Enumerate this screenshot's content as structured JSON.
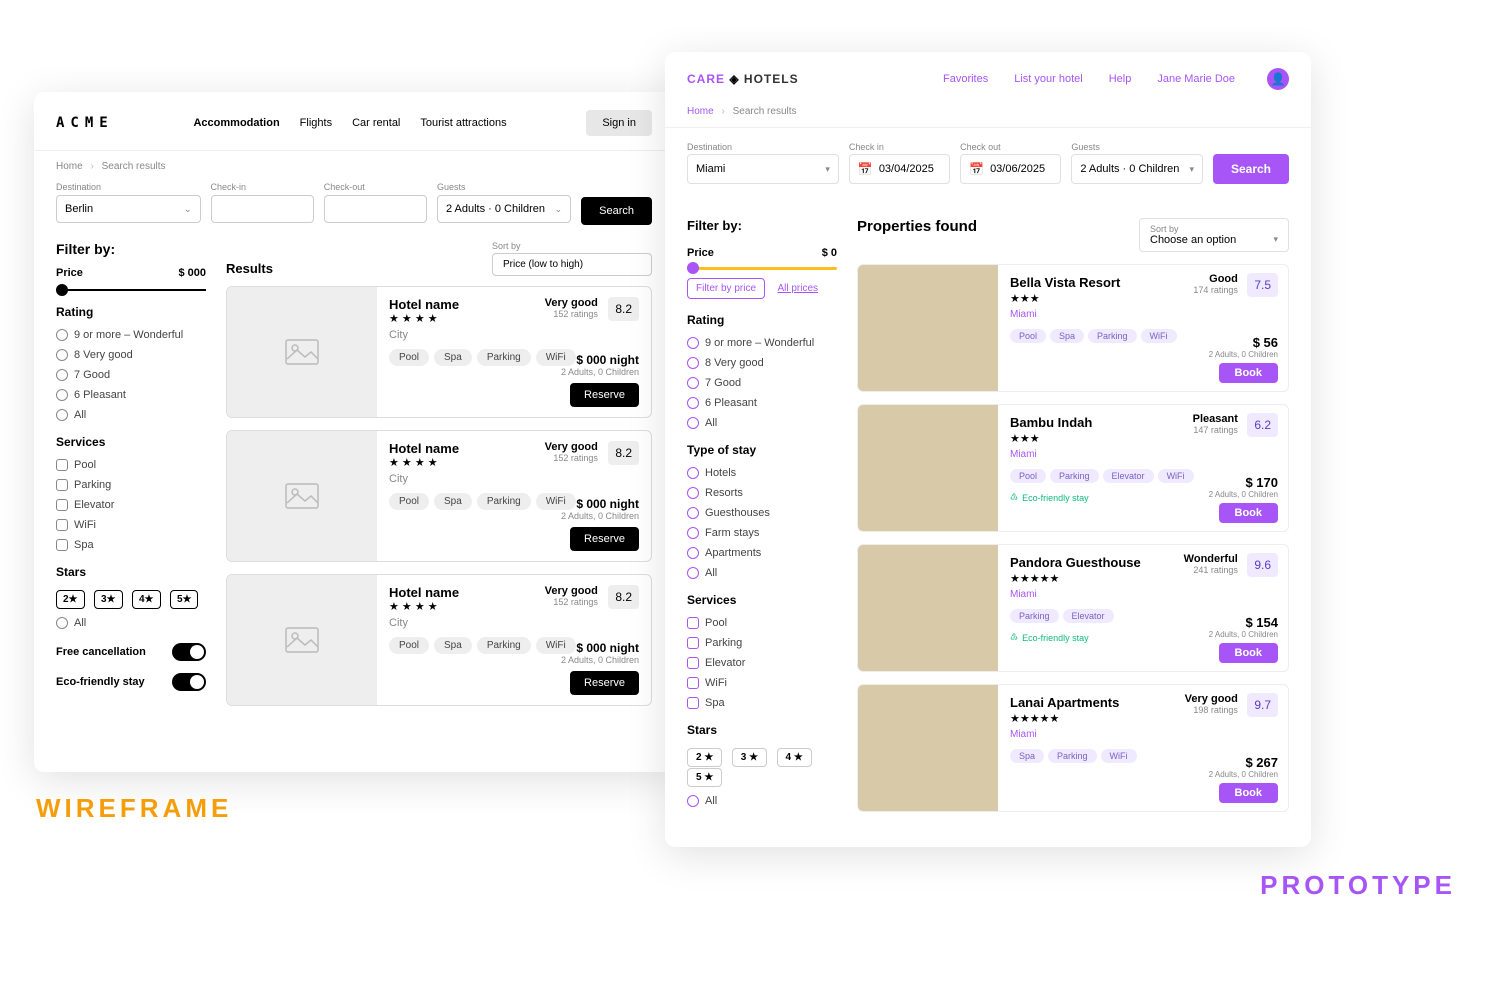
{
  "labels": {
    "wireframe": "WIREFRAME",
    "prototype": "PROTOTYPE"
  },
  "wire": {
    "brand": "ACME",
    "nav": [
      "Accommodation",
      "Flights",
      "Car rental",
      "Tourist attractions"
    ],
    "signin": "Sign in",
    "crumbs": {
      "home": "Home",
      "current": "Search results"
    },
    "search": {
      "destination_label": "Destination",
      "destination": "Berlin",
      "checkin_label": "Check-in",
      "checkin": "",
      "checkout_label": "Check-out",
      "checkout": "",
      "guests_label": "Guests",
      "guests": "2 Adults  ·  0 Children",
      "button": "Search"
    },
    "filter_by": "Filter by:",
    "price_label": "Price",
    "price_value": "$  000",
    "rating_label": "Rating",
    "ratings": [
      "9 or more – Wonderful",
      "8 Very good",
      "7 Good",
      "6 Pleasant",
      "All"
    ],
    "services_label": "Services",
    "services": [
      "Pool",
      "Parking",
      "Elevator",
      "WiFi",
      "Spa"
    ],
    "stars_label": "Stars",
    "stars": [
      "2★",
      "3★",
      "4★",
      "5★"
    ],
    "stars_all": "All",
    "freecancel": "Free cancellation",
    "ecofriendly": "Eco-friendly stay",
    "results_title": "Results",
    "sort_label": "Sort by",
    "sort_value": "Price (low to high)",
    "card": {
      "name": "Hotel name",
      "city": "City",
      "tags": [
        "Pool",
        "Spa",
        "Parking",
        "WiFi"
      ],
      "rmet": "Very good",
      "rct": "152 ratings",
      "score": "8.2",
      "price": "$ 000 night",
      "sub": "2 Adults,  0 Children",
      "reserve": "Reserve"
    }
  },
  "proto": {
    "logo": {
      "care": "CARE ",
      "hotels": "HOTELS"
    },
    "nav": [
      "Favorites",
      "List your hotel",
      "Help"
    ],
    "user": "Jane Marie Doe",
    "crumbs": {
      "home": "Home",
      "current": "Search results"
    },
    "search": {
      "destination_label": "Destination",
      "destination": "Miami",
      "checkin_label": "Check in",
      "checkin": "03/04/2025",
      "checkout_label": "Check out",
      "checkout": "03/06/2025",
      "guests_label": "Guests",
      "guests": "2 Adults  ·  0 Children",
      "button": "Search"
    },
    "filter_by": "Filter by:",
    "price_label": "Price",
    "price_value": "$     0",
    "filter_price_btn": "Filter by price",
    "all_prices": "All prices",
    "rating_label": "Rating",
    "ratings": [
      "9 or more – Wonderful",
      "8 Very good",
      "7 Good",
      "6 Pleasant",
      "All"
    ],
    "type_label": "Type of stay",
    "types": [
      "Hotels",
      "Resorts",
      "Guesthouses",
      "Farm stays",
      "Apartments",
      "All"
    ],
    "services_label": "Services",
    "services": [
      "Pool",
      "Parking",
      "Elevator",
      "WiFi",
      "Spa"
    ],
    "stars_label": "Stars",
    "stars": [
      "2 ★",
      "3 ★",
      "4 ★",
      "5 ★"
    ],
    "stars_all": "All",
    "results_title": "Properties found",
    "sort_label": "Sort by",
    "sort_value": "Choose an option",
    "eco_text": "Eco-friendly stay",
    "cards": [
      {
        "name": "Bella Vista Resort",
        "stars": "★★★",
        "city": "Miami",
        "tags": [
          "Pool",
          "Spa",
          "Parking",
          "WiFi"
        ],
        "eco": false,
        "rmet": "Good",
        "rct": "174 ratings",
        "score": "7.5",
        "price": "$   56",
        "sub": "2 Adults,  0 Children",
        "book": "Book",
        "thumb": "t1"
      },
      {
        "name": "Bambu Indah",
        "stars": "★★★",
        "city": "Miami",
        "tags": [
          "Pool",
          "Parking",
          "Elevator",
          "WiFi"
        ],
        "eco": true,
        "rmet": "Pleasant",
        "rct": "147 ratings",
        "score": "6.2",
        "price": "$ 170",
        "sub": "2 Adults,  0 Children",
        "book": "Book",
        "thumb": "t2"
      },
      {
        "name": "Pandora Guesthouse",
        "stars": "★★★★★",
        "city": "Miami",
        "tags": [
          "Parking",
          "Elevator"
        ],
        "eco": true,
        "rmet": "Wonderful",
        "rct": "241  ratings",
        "score": "9.6",
        "price": "$ 154",
        "sub": "2 Adults,  0 Children",
        "book": "Book",
        "thumb": "t3"
      },
      {
        "name": "Lanai Apartments",
        "stars": "★★★★★",
        "city": "Miami",
        "tags": [
          "Spa",
          "Parking",
          "WiFi"
        ],
        "eco": false,
        "rmet": "Very good",
        "rct": "198  ratings",
        "score": "9.7",
        "price": "$ 267",
        "sub": "2 Adults,  0 Children",
        "book": "Book",
        "thumb": "t4"
      }
    ]
  }
}
